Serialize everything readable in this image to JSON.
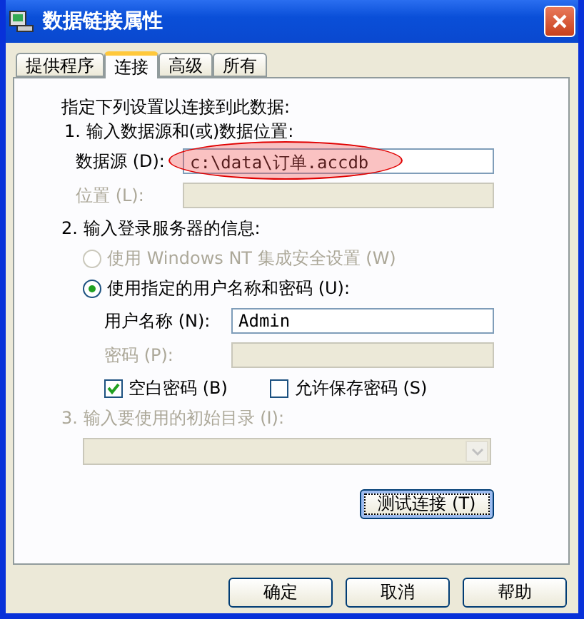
{
  "window": {
    "title": "数据链接属性"
  },
  "tabs": [
    {
      "label": "提供程序",
      "selected": false
    },
    {
      "label": "连接",
      "selected": true
    },
    {
      "label": "高级",
      "selected": false
    },
    {
      "label": "所有",
      "selected": false
    }
  ],
  "intro": "指定下列设置以连接到此数据:",
  "step1": {
    "label": "1. 输入数据源和(或)数据位置:",
    "fields": [
      {
        "label": "数据源 (D):",
        "value": "c:\\data\\订单.accdb",
        "disabled": false,
        "highlighted": true
      },
      {
        "label": "位置 (L):",
        "disabled": true,
        "highlighted": false
      }
    ]
  },
  "step2": {
    "label": "2. 输入登录服务器的信息:",
    "options": [
      {
        "label": "使用 Windows NT 集成安全设置 (W)",
        "selected": false,
        "disabled": true
      },
      {
        "label": "使用指定的用户名称和密码 (U):",
        "selected": true,
        "disabled": false
      }
    ],
    "fields": [
      {
        "label": "用户名称 (N):",
        "value": "Admin",
        "disabled": false
      },
      {
        "label": "密码 (P):",
        "disabled": true
      }
    ],
    "checkboxes": [
      {
        "label": "空白密码 (B)",
        "checked": true
      },
      {
        "label": "允许保存密码 (S)",
        "checked": false
      }
    ]
  },
  "step3": {
    "label": "3. 输入要使用的初始目录 (I):",
    "disabled": true
  },
  "test_button": "测试连接 (T)",
  "buttons": [
    "确定",
    "取消",
    "帮助"
  ]
}
